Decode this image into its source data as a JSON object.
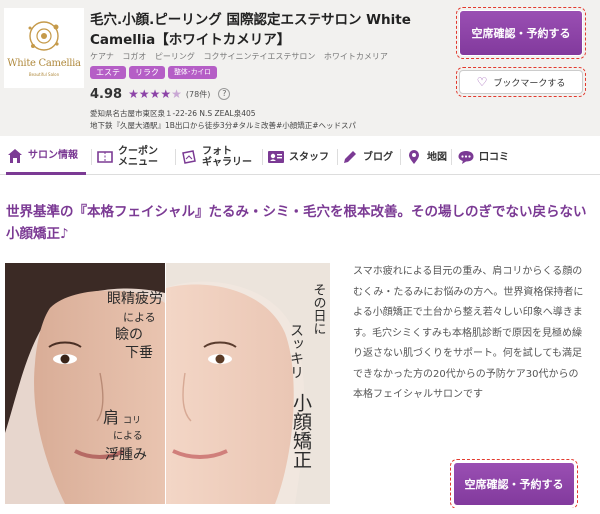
{
  "header": {
    "logo": {
      "text": "White Camellia",
      "subtext": "Beautiful Salon"
    },
    "title": "毛穴.小顔.ピーリング 国際認定エステサロン White Camellia【ホワイトカメリア】",
    "kana_tags": "ケアナ コガオ ピーリング コクサイニンテイエステサロン ホワイトカメリア",
    "category_tags": [
      "エステ",
      "リラク",
      "整体･カイロ"
    ],
    "rating": {
      "value": "4.98",
      "stars": 4.98,
      "count": "(78件)",
      "help": "?"
    },
    "address": "愛知県名古屋市東区泉１-22-26 N.S ZEAL泉405",
    "access": "地下鉄『久屋大通駅』1B出口から徒歩3分#タルミ改善#小顔矯正#ヘッドスパ",
    "reserve_button": "空席確認・予約する",
    "bookmark_button": "ブックマークする",
    "bookmark_icon": "heart-icon"
  },
  "nav": {
    "tabs": [
      {
        "label": "サロン情報",
        "icon": "home-icon",
        "active": true
      },
      {
        "label": "クーポン\nメニュー",
        "icon": "coupon-icon",
        "active": false
      },
      {
        "label": "フォト\nギャラリー",
        "icon": "photo-icon",
        "active": false
      },
      {
        "label": "スタッフ",
        "icon": "staff-icon",
        "active": false
      },
      {
        "label": "ブログ",
        "icon": "pencil-icon",
        "active": false
      },
      {
        "label": "地図",
        "icon": "map-pin-icon",
        "active": false
      },
      {
        "label": "口コミ",
        "icon": "chat-bubble-icon",
        "active": false
      }
    ]
  },
  "main": {
    "headline": "世界基準の『本格フェイシャル』たるみ・シミ・毛穴を根本改善。その場しのぎでない戻らない小顔矯正♪",
    "hero": {
      "left_caption_1": "眼精疲労",
      "left_caption_2": "による",
      "left_caption_3": "瞼の",
      "left_caption_4": "下垂",
      "left_caption_5": "肩",
      "left_caption_6": "コリ",
      "left_caption_7": "による",
      "left_caption_8": "浮腫み",
      "right_caption_1": "その日に",
      "right_caption_2": "スッキリ",
      "right_caption_3": "小顔矯正"
    },
    "description": "スマホ疲れによる目元の重み、肩コリからくる顔のむくみ・たるみにお悩みの方へ。世界資格保持者による小顔矯正で土台から整え若々しい印象へ導きます。毛穴シミくすみも本格肌診断で原因を見極め繰り返さない肌づくりをサポート。何を試しても満足できなかった方の20代からの予防ケア30代からの本格フェイシャルサロンです",
    "reserve_button": "空席確認・予約する"
  },
  "colors": {
    "accent": "#7b3a94",
    "button": "#8d44a8",
    "tag": "#b55ec6",
    "header_bg": "#f2f1ef",
    "outline": "#e23a2e"
  }
}
